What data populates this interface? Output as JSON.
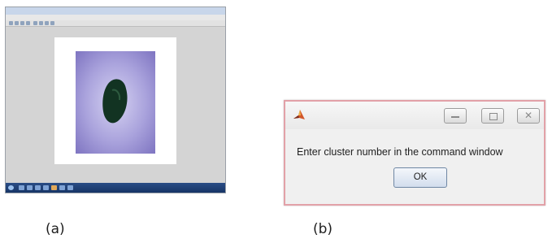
{
  "figure_a": {
    "caption": "(a)"
  },
  "dialog_b": {
    "caption": "(b)",
    "message": "Enter cluster number in the command window",
    "ok_label": "OK",
    "icons": [
      "matlab-logo-icon",
      "minimize-icon",
      "maximize-icon",
      "close-icon"
    ]
  }
}
